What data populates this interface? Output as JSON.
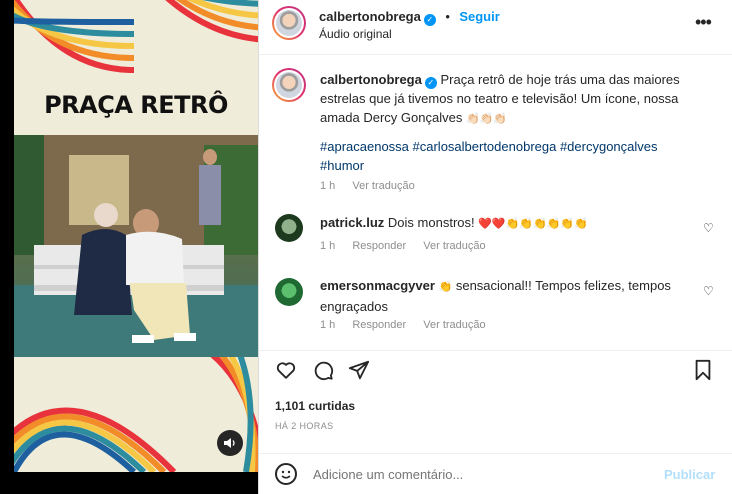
{
  "media": {
    "title": "PRAÇA RETRÔ",
    "sound_icon": "speaker-icon"
  },
  "header": {
    "username": "calbertonobrega",
    "separator": "•",
    "follow_label": "Seguir",
    "audio_label": "Áudio original",
    "more_icon": "more-options-icon"
  },
  "caption": {
    "username": "calbertonobrega",
    "text": "Praça retrô de hoje trás uma das maiores estrelas que já tivemos no teatro e televisão! Um ícone, nossa amada Dercy Gonçalves",
    "clap_emojis": "👏🏻👏🏻👏🏻",
    "hashtags_line1": "#apracaenossa #carlosalbertodenobrega #dercygonçalves",
    "hashtags_line2": "#humor",
    "time": "1 h",
    "translate_label": "Ver tradução"
  },
  "comments": [
    {
      "username": "patrick.luz",
      "text": "Dois monstros! ",
      "emojis": "❤️❤️👏👏👏👏👏👏",
      "time": "1 h",
      "reply_label": "Responder",
      "translate_label": "Ver tradução"
    },
    {
      "username": "emersonmacgyver",
      "emoji": "👏",
      "text": " sensacional!! Tempos felizes, tempos engraçados",
      "time": "1 h",
      "reply_label": "Responder",
      "translate_label": "Ver tradução"
    }
  ],
  "actions": {
    "like_icon": "heart-icon",
    "comment_icon": "comment-icon",
    "share_icon": "share-icon",
    "save_icon": "bookmark-icon"
  },
  "likes_label": "1,101 curtidas",
  "time_ago": "HÁ 2 HORAS",
  "composer": {
    "emoji_icon": "emoji-icon",
    "placeholder": "Adicione um comentário...",
    "publish_label": "Publicar"
  },
  "colors": {
    "accent": "#0095f6",
    "hashtag": "#00376b",
    "muted": "#8e8e8e",
    "publish_disabled": "#b2dffc",
    "rainbow": [
      "#e8323c",
      "#f28c28",
      "#f6c744",
      "#2d8c9e",
      "#1e5fa0"
    ]
  }
}
